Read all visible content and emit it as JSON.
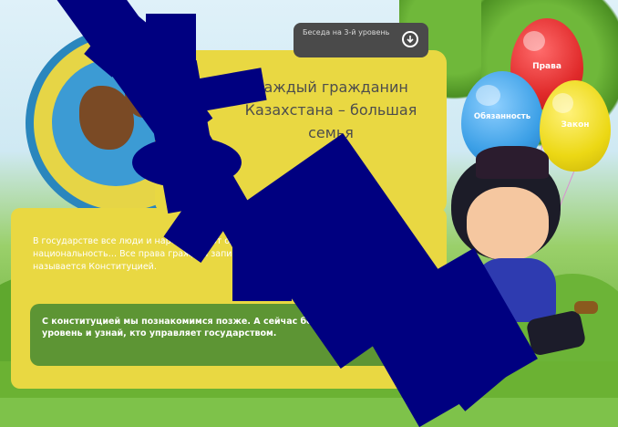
{
  "scene": {
    "card_title": "Каждый гражданин Казахстана – большая семья",
    "card_text": "В государстве все люди и народы имеют одинаковые права… национальность… Все права граждан записаны в книге, которая называется Конституцией.",
    "note_text": "С конституцией мы познакомимся позже. А сейчас беги на 3-й уровень и узнай, кто управляет государством."
  },
  "topbar": {
    "text": "Беседа на 3-й уровень",
    "download_icon": "download-circle-icon"
  },
  "balloons": [
    {
      "label": "Права",
      "color": "#e02a2a"
    },
    {
      "label": "Обязанность",
      "color": "#3b9fe6"
    },
    {
      "label": "Закон",
      "color": "#ecd814"
    }
  ],
  "colors": {
    "card": "#e9d842",
    "note": "#5d9534",
    "overlay": "#000080",
    "topbar": "#4a4a4a"
  }
}
